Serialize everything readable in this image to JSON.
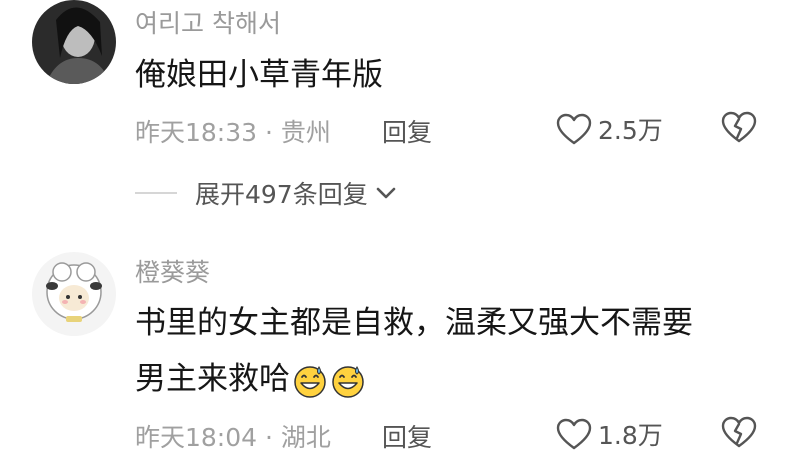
{
  "comments": [
    {
      "username": "여리고 착해서",
      "content": "俺娘田小草青年版",
      "time_location": "昨天18:33 · 贵州",
      "reply_label": "回复",
      "likes": "2.5万",
      "expand_label": "展开497条回复"
    },
    {
      "username": "橙葵葵",
      "content_line1": "书里的女主都是自救，温柔又强大不需要",
      "content_line2": "男主来救哈",
      "time_location": "昨天18:04 · 湖北",
      "reply_label": "回复",
      "likes": "1.8万"
    }
  ]
}
